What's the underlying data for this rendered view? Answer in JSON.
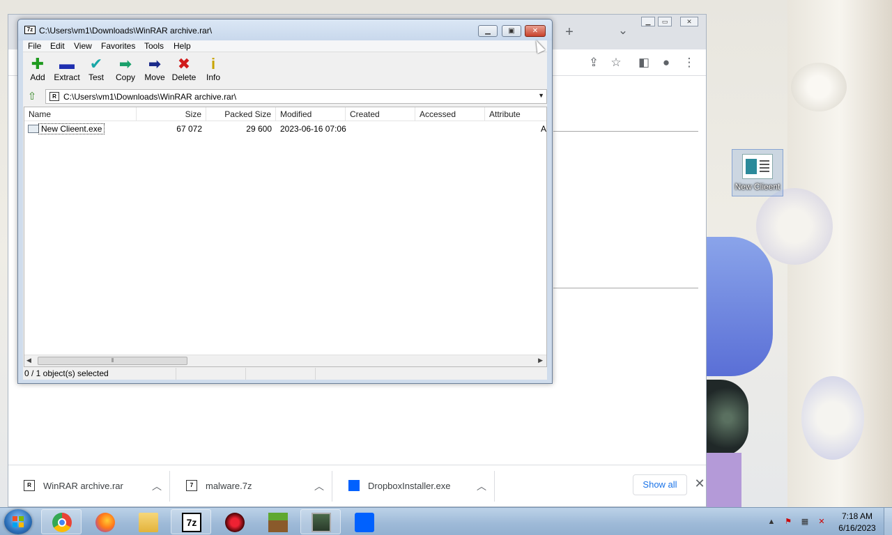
{
  "desktop": {
    "icon_label": "New Clieent"
  },
  "chrome": {
    "new_tab_symbol": "+",
    "tab_search_symbol": "⌄",
    "downloads": [
      {
        "name": "WinRAR archive.rar",
        "icon": "rar-archive-icon"
      },
      {
        "name": "malware.7z",
        "icon": "7z-archive-icon"
      },
      {
        "name": "DropboxInstaller.exe",
        "icon": "dropbox-icon"
      }
    ],
    "show_all_label": "Show all"
  },
  "zip_window": {
    "title": "C:\\Users\\vm1\\Downloads\\WinRAR archive.rar\\",
    "menu": [
      "File",
      "Edit",
      "View",
      "Favorites",
      "Tools",
      "Help"
    ],
    "toolbar": [
      {
        "label": "Add",
        "icon": "add-icon",
        "glyph": "✚",
        "color": "#1f9a1f"
      },
      {
        "label": "Extract",
        "icon": "extract-icon",
        "glyph": "▬",
        "color": "#1f2fb0"
      },
      {
        "label": "Test",
        "icon": "test-icon",
        "glyph": "✔",
        "color": "#19a7a7"
      },
      {
        "label": "Copy",
        "icon": "copy-icon",
        "glyph": "➡",
        "color": "#19a06a"
      },
      {
        "label": "Move",
        "icon": "move-icon",
        "glyph": "➡",
        "color": "#1a2a8a"
      },
      {
        "label": "Delete",
        "icon": "delete-icon",
        "glyph": "✖",
        "color": "#d01c1c"
      },
      {
        "label": "Info",
        "icon": "info-icon",
        "glyph": "i",
        "color": "#c8a400"
      }
    ],
    "address": "C:\\Users\\vm1\\Downloads\\WinRAR archive.rar\\",
    "columns": [
      "Name",
      "Size",
      "Packed Size",
      "Modified",
      "Created",
      "Accessed",
      "Attribute"
    ],
    "rows": [
      {
        "name": "New Clieent.exe",
        "size": "67 072",
        "packed": "29 600",
        "modified": "2023-06-16 07:06",
        "created": "",
        "accessed": "",
        "attr": "A"
      }
    ],
    "status": "0 / 1 object(s) selected"
  },
  "taskbar": {
    "apps": [
      "chrome-icon",
      "firefox-icon",
      "file-explorer-icon",
      "7zip-icon",
      "app-red-icon",
      "minecraft-icon",
      "remote-desktop-icon",
      "dropbox-icon"
    ],
    "time": "7:18 AM",
    "date": "6/16/2023"
  }
}
